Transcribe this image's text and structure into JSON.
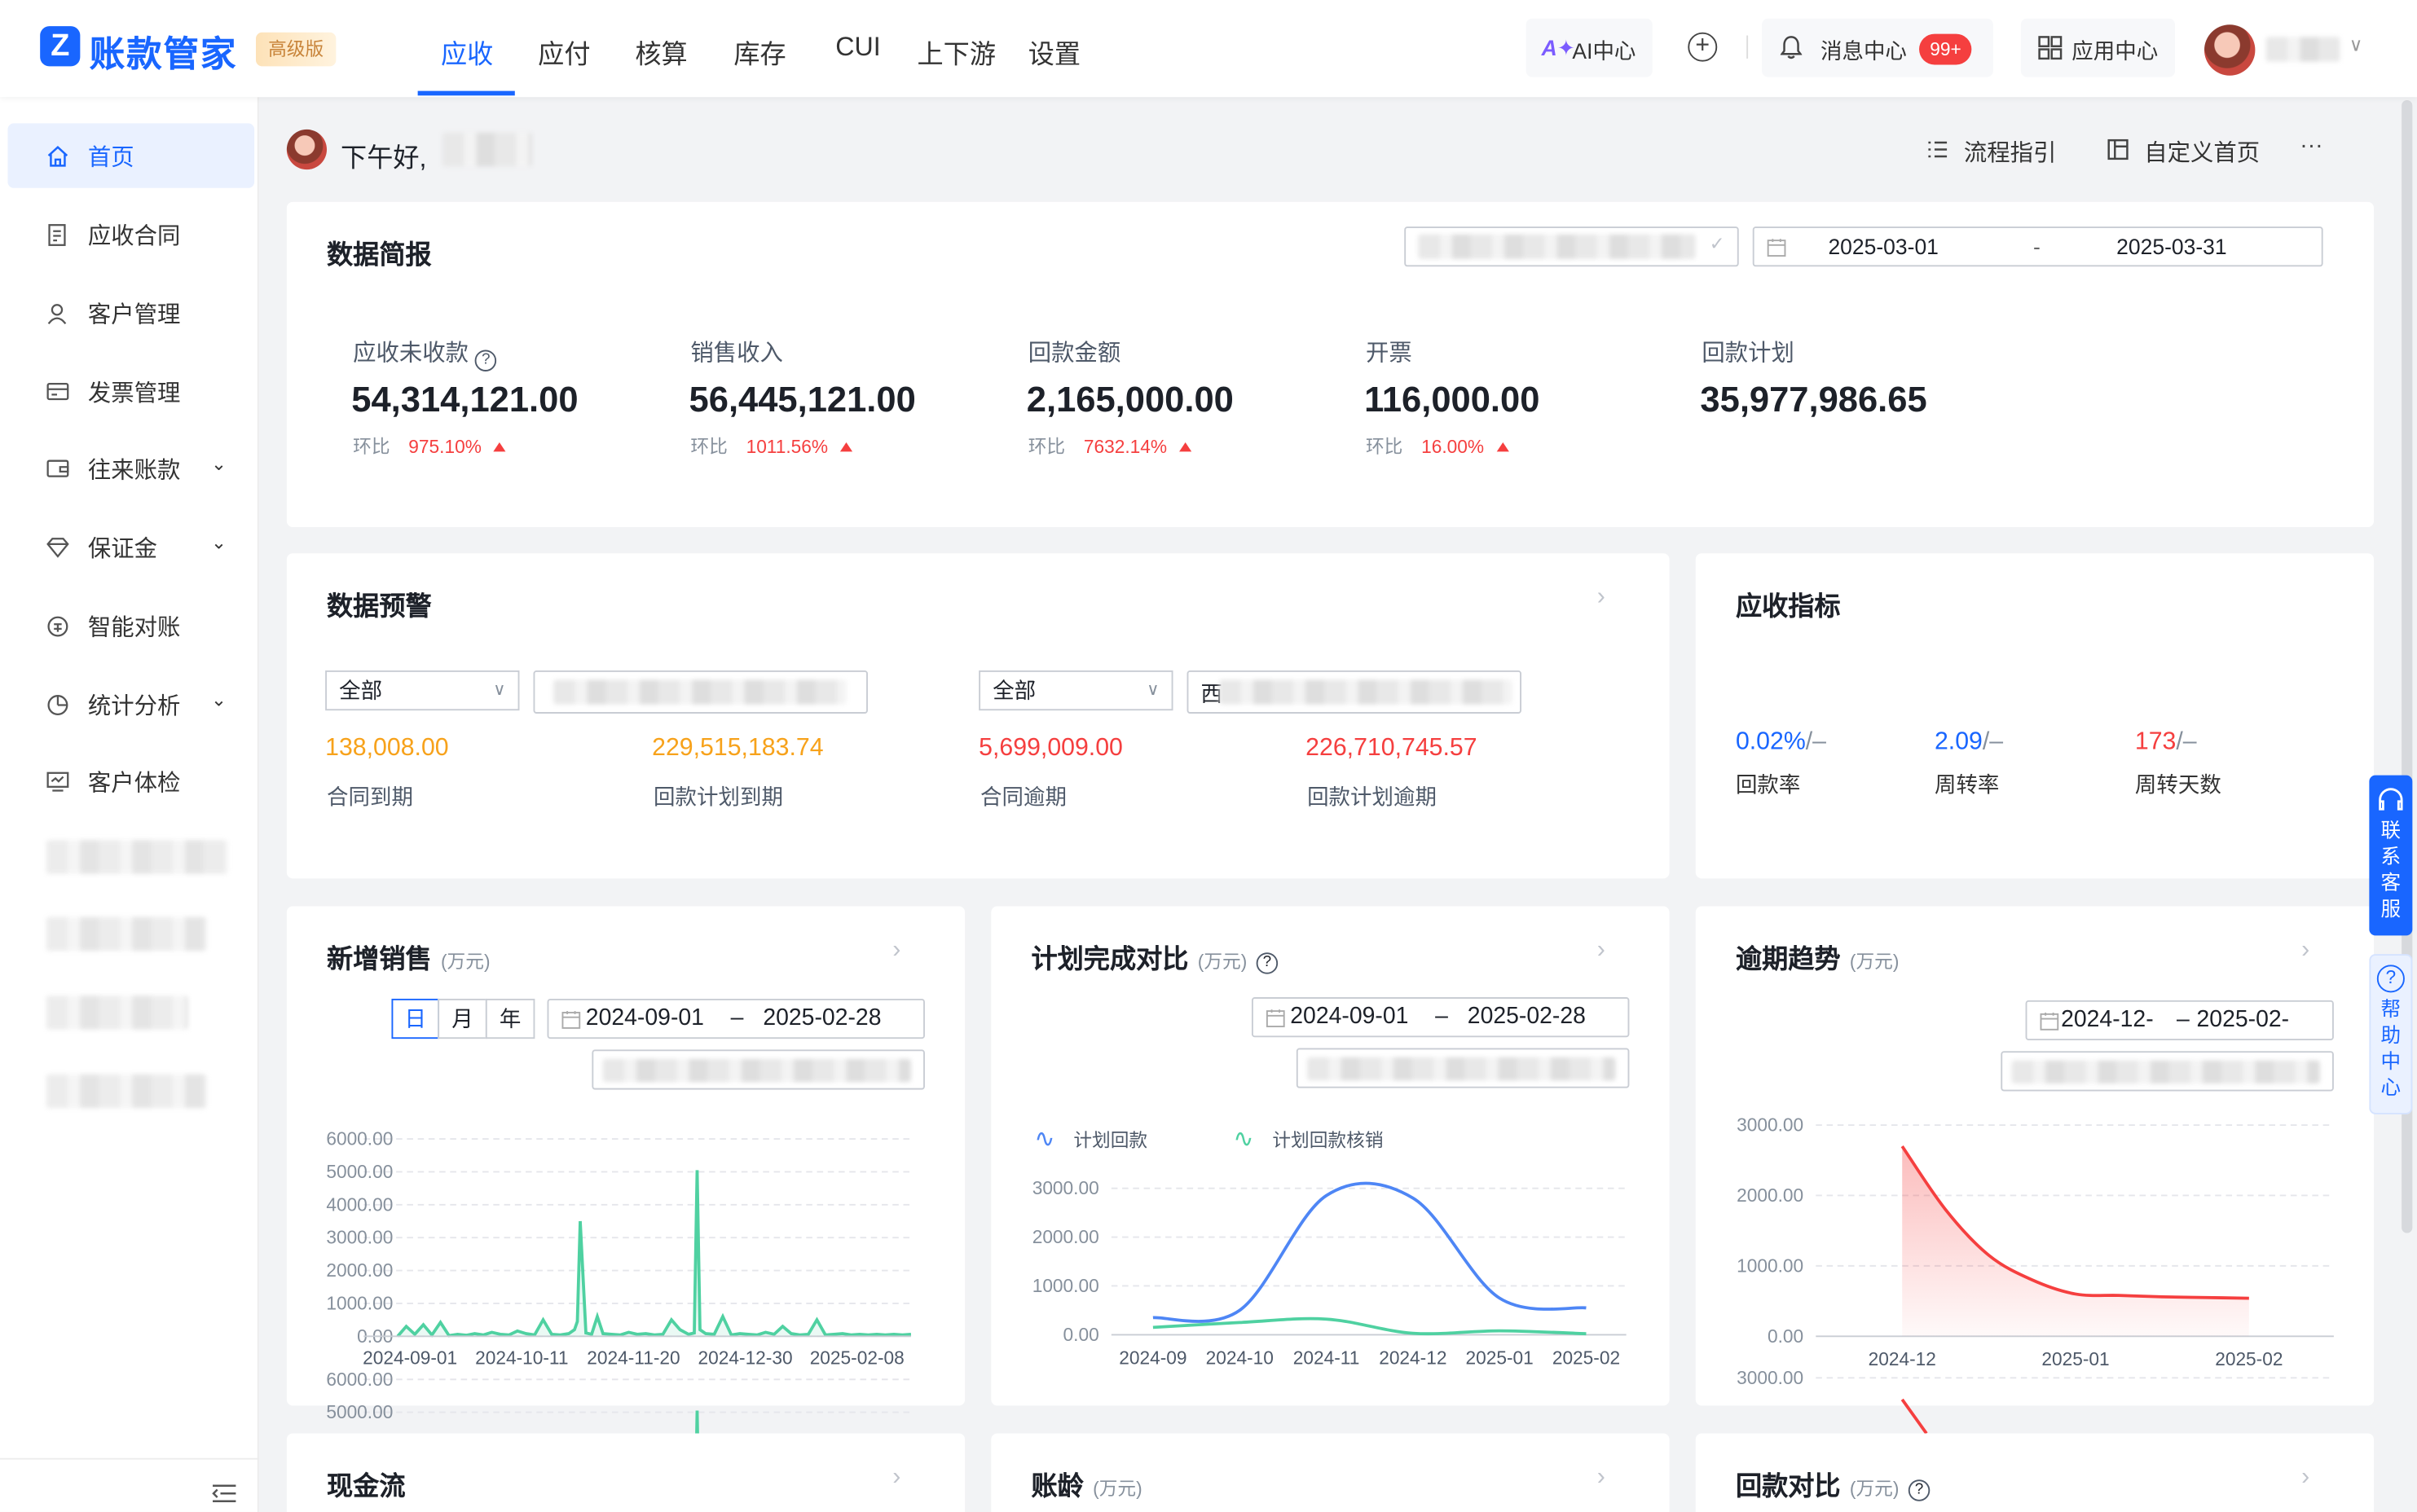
{
  "brand": {
    "logo_letter": "Z",
    "name": "账款管家",
    "edition": "高级版"
  },
  "nav": [
    {
      "label": "应收",
      "active": true
    },
    {
      "label": "应付"
    },
    {
      "label": "核算"
    },
    {
      "label": "库存"
    },
    {
      "label": "CUI"
    },
    {
      "label": "上下游"
    },
    {
      "label": "设置"
    }
  ],
  "topbar": {
    "ai": "AI中心",
    "messages": "消息中心",
    "msg_badge": "99+",
    "apps": "应用中心"
  },
  "sidebar": [
    {
      "label": "首页",
      "icon": "home-icon",
      "active": true
    },
    {
      "label": "应收合同",
      "icon": "contract-icon"
    },
    {
      "label": "客户管理",
      "icon": "user-icon"
    },
    {
      "label": "发票管理",
      "icon": "invoice-icon"
    },
    {
      "label": "往来账款",
      "icon": "wallet-icon",
      "expand": true
    },
    {
      "label": "保证金",
      "icon": "diamond-icon",
      "expand": true
    },
    {
      "label": "智能对账",
      "icon": "reconcile-icon"
    },
    {
      "label": "统计分析",
      "icon": "pie-icon",
      "expand": true
    },
    {
      "label": "客户体检",
      "icon": "monitor-icon"
    }
  ],
  "greeting": "下午好,",
  "actions": {
    "guide": "流程指引",
    "custom": "自定义首页",
    "more": "···"
  },
  "summary": {
    "title": "数据简报",
    "date_from": "2025-03-01",
    "date_sep": "-",
    "date_to": "2025-03-31",
    "ratio_label": "环比",
    "kpis": [
      {
        "label": "应收未收款",
        "value": "54,314,121.00",
        "ratio": "975.10%",
        "help": true
      },
      {
        "label": "销售收入",
        "value": "56,445,121.00",
        "ratio": "1011.56%"
      },
      {
        "label": "回款金额",
        "value": "2,165,000.00",
        "ratio": "7632.14%"
      },
      {
        "label": "开票",
        "value": "116,000.00",
        "ratio": "16.00%"
      },
      {
        "label": "回款计划",
        "value": "35,977,986.65"
      }
    ]
  },
  "warning": {
    "title": "数据预警",
    "filter1": "全部",
    "filter2": "全部",
    "filter2_suffix": "西",
    "items": [
      {
        "value": "138,008.00",
        "label": "合同到期",
        "color": "#f7a21b"
      },
      {
        "value": "229,515,183.74",
        "label": "回款计划到期",
        "color": "#f7a21b"
      },
      {
        "value": "5,699,009.00",
        "label": "合同逾期",
        "color": "#f53f3f"
      },
      {
        "value": "226,710,745.57",
        "label": "回款计划逾期",
        "color": "#f53f3f"
      }
    ]
  },
  "indicators": {
    "title": "应收指标",
    "items": [
      {
        "value": "0.02%",
        "suffix": "/–",
        "label": "回款率"
      },
      {
        "value": "2.09",
        "suffix": "/–",
        "label": "周转率"
      },
      {
        "value": "173",
        "suffix": "/–",
        "label": "周转天数",
        "color": "#f53f3f"
      }
    ]
  },
  "sales": {
    "title": "新增销售",
    "unit": "(万元)",
    "seg": [
      "日",
      "月",
      "年"
    ],
    "date_from": "2024-09-01",
    "date_sep": "–",
    "date_to": "2025-02-28"
  },
  "plan": {
    "title": "计划完成对比",
    "unit": "(万元)",
    "date_from": "2024-09-01",
    "date_sep": "–",
    "date_to": "2025-02-28",
    "legend": [
      "计划回款",
      "计划回款核销"
    ]
  },
  "overdue": {
    "title": "逾期趋势",
    "unit": "(万元)",
    "date_from": "2024-12-",
    "date_sep": "–",
    "date_to": "2025-02-"
  },
  "bottom": {
    "cash": "现金流",
    "aging": "账龄",
    "aging_unit": "(万元)",
    "compare": "回款对比",
    "compare_unit": "(万元)"
  },
  "float": {
    "service": "联系客服",
    "help": "帮助中心"
  },
  "chart_data": [
    {
      "type": "area",
      "title": "新增销售",
      "x_ticks": [
        "2024-09-01",
        "2024-10-11",
        "2024-11-20",
        "2024-12-30",
        "2025-02-08"
      ],
      "y_ticks": [
        "6000.00",
        "5000.00",
        "4000.00",
        "3000.00",
        "2000.00",
        "1000.00",
        "0.00"
      ],
      "ylim": [
        0,
        6000
      ],
      "xlim": [
        0,
        180
      ],
      "x_days": [
        0,
        3,
        6,
        9,
        12,
        15,
        18,
        21,
        24,
        27,
        30,
        33,
        36,
        39,
        42,
        45,
        48,
        51,
        54,
        57,
        60,
        62,
        63,
        64,
        66,
        68,
        70,
        72,
        75,
        78,
        81,
        84,
        87,
        90,
        93,
        96,
        99,
        102,
        104,
        105,
        106,
        108,
        111,
        114,
        117,
        120,
        123,
        126,
        129,
        132,
        135,
        138,
        141,
        144,
        147,
        150,
        153,
        156,
        159,
        162,
        165,
        168,
        171,
        174,
        177,
        180
      ],
      "values": [
        0,
        300,
        60,
        350,
        40,
        420,
        20,
        60,
        30,
        80,
        40,
        120,
        60,
        40,
        160,
        80,
        40,
        500,
        60,
        40,
        80,
        200,
        450,
        3500,
        100,
        60,
        600,
        80,
        60,
        40,
        120,
        60,
        80,
        40,
        60,
        500,
        200,
        60,
        100,
        5050,
        200,
        80,
        60,
        600,
        40,
        80,
        60,
        40,
        120,
        60,
        300,
        80,
        40,
        60,
        500,
        40,
        60,
        80,
        40,
        60,
        40,
        60,
        40,
        60,
        40,
        60
      ]
    },
    {
      "type": "line",
      "title": "计划完成对比",
      "categories": [
        "2024-09",
        "2024-10",
        "2024-11",
        "2024-12",
        "2025-01",
        "2025-02"
      ],
      "y_ticks": [
        "3000.00",
        "2000.00",
        "1000.00",
        "0.00"
      ],
      "ylim": [
        0,
        3000
      ],
      "series": [
        {
          "name": "计划回款",
          "color": "#4e86f5",
          "values": [
            350,
            500,
            2850,
            2800,
            750,
            550
          ]
        },
        {
          "name": "计划回款核销",
          "color": "#4fd1a1",
          "values": [
            150,
            250,
            320,
            30,
            80,
            20
          ]
        }
      ]
    },
    {
      "type": "area",
      "title": "逾期趋势",
      "categories": [
        "2024-12",
        "2025-01",
        "2025-02"
      ],
      "y_ticks": [
        "3000.00",
        "2000.00",
        "1000.00",
        "0.00"
      ],
      "ylim": [
        0,
        3000
      ],
      "x": [
        0,
        0.125,
        0.25,
        0.375,
        0.5,
        0.625,
        0.75,
        0.875,
        1
      ],
      "values": [
        2700,
        1800,
        1150,
        800,
        600,
        580,
        560,
        550,
        540
      ],
      "color": "#f53f3f"
    }
  ]
}
